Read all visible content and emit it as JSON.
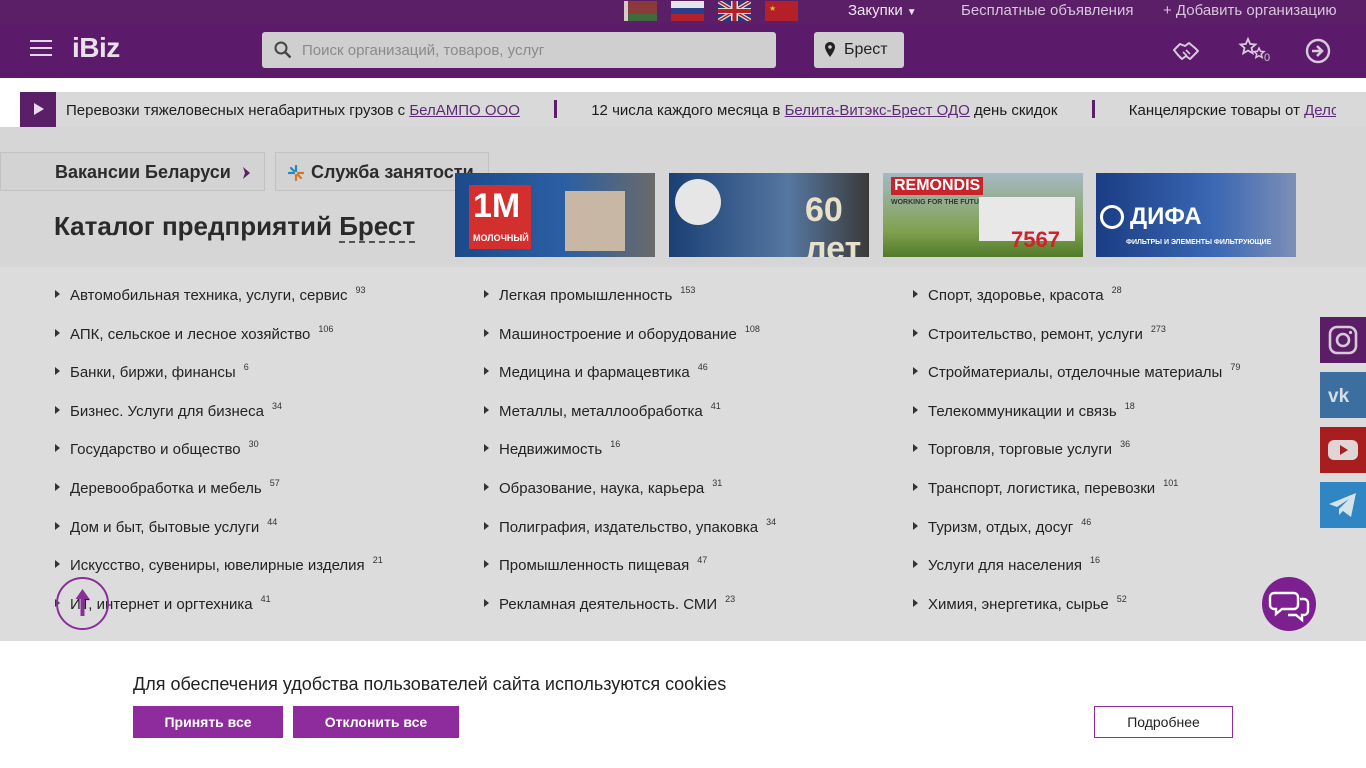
{
  "topbar": {
    "flags": [
      "belarus-flag",
      "russia-flag",
      "uk-flag",
      "china-flag"
    ],
    "zakupki": "Закупки",
    "free_ads": "Бесплатные объявления",
    "add_org": "+ Добавить организацию"
  },
  "header": {
    "logo": "iBiz",
    "search_placeholder": "Поиск организаций, товаров, услуг",
    "city": "Брест",
    "favorites_count": "0"
  },
  "ticker": {
    "items": [
      {
        "prefix": "Перевозки тяжеловесных негабаритных грузов с ",
        "link": "БелАМПО ООО",
        "suffix": ""
      },
      {
        "prefix": "12 числа каждого месяца в ",
        "link": "Белита-Витэкс-Брест ОДО",
        "suffix": " день скидок"
      },
      {
        "prefix": "Канцелярские товары от ",
        "link": "Дело",
        "suffix": ""
      }
    ]
  },
  "buttons": {
    "vacancies": "Вакансии Беларуси",
    "employment": "Служба занятости"
  },
  "catalog": {
    "title": "Каталог предприятий",
    "city": "Брест"
  },
  "banners": {
    "b1": "1М МОЛОЧНЫЙ",
    "b2": "60 лет",
    "b3_brand": "REMONDIS",
    "b3_sub": "WORKING FOR THE FUTURE",
    "b3_num": "7567",
    "b4": "ДИФА",
    "b4_sub": "ФИЛЬТРЫ И ЭЛЕМЕНТЫ ФИЛЬТРУЮЩИЕ"
  },
  "categories": {
    "col1": [
      {
        "label": "Автомобильная техника, услуги, сервис",
        "count": "93"
      },
      {
        "label": "АПК, сельское и лесное хозяйство",
        "count": "106"
      },
      {
        "label": "Банки, биржи, финансы",
        "count": "6"
      },
      {
        "label": "Бизнес. Услуги для бизнеса",
        "count": "34"
      },
      {
        "label": "Государство и общество",
        "count": "30"
      },
      {
        "label": "Деревообработка и мебель",
        "count": "57"
      },
      {
        "label": "Дом и быт, бытовые услуги",
        "count": "44"
      },
      {
        "label": "Искусство, сувениры, ювелирные изделия",
        "count": "21"
      },
      {
        "label": "ИТ, интернет и оргтехника",
        "count": "41"
      }
    ],
    "col2": [
      {
        "label": "Легкая промышленность",
        "count": "153"
      },
      {
        "label": "Машиностроение и оборудование",
        "count": "108"
      },
      {
        "label": "Медицина и фармацевтика",
        "count": "46"
      },
      {
        "label": "Металлы, металлообработка",
        "count": "41"
      },
      {
        "label": "Недвижимость",
        "count": "16"
      },
      {
        "label": "Образование, наука, карьера",
        "count": "31"
      },
      {
        "label": "Полиграфия, издательство, упаковка",
        "count": "34"
      },
      {
        "label": "Промышленность пищевая",
        "count": "47"
      },
      {
        "label": "Рекламная деятельность. СМИ",
        "count": "23"
      }
    ],
    "col3": [
      {
        "label": "Спорт, здоровье, красота",
        "count": "28"
      },
      {
        "label": "Строительство, ремонт, услуги",
        "count": "273"
      },
      {
        "label": "Стройматериалы, отделочные материалы",
        "count": "79"
      },
      {
        "label": "Телекоммуникации и связь",
        "count": "18"
      },
      {
        "label": "Торговля, торговые услуги",
        "count": "36"
      },
      {
        "label": "Транспорт, логистика, перевозки",
        "count": "101"
      },
      {
        "label": "Туризм, отдых, досуг",
        "count": "46"
      },
      {
        "label": "Услуги для населения",
        "count": "16"
      },
      {
        "label": "Химия, энергетика, сырье",
        "count": "52"
      }
    ]
  },
  "cookie": {
    "text": "Для обеспечения удобства пользователей сайта используются cookies",
    "accept": "Принять все",
    "decline": "Отклонить все",
    "more": "Подробнее"
  }
}
